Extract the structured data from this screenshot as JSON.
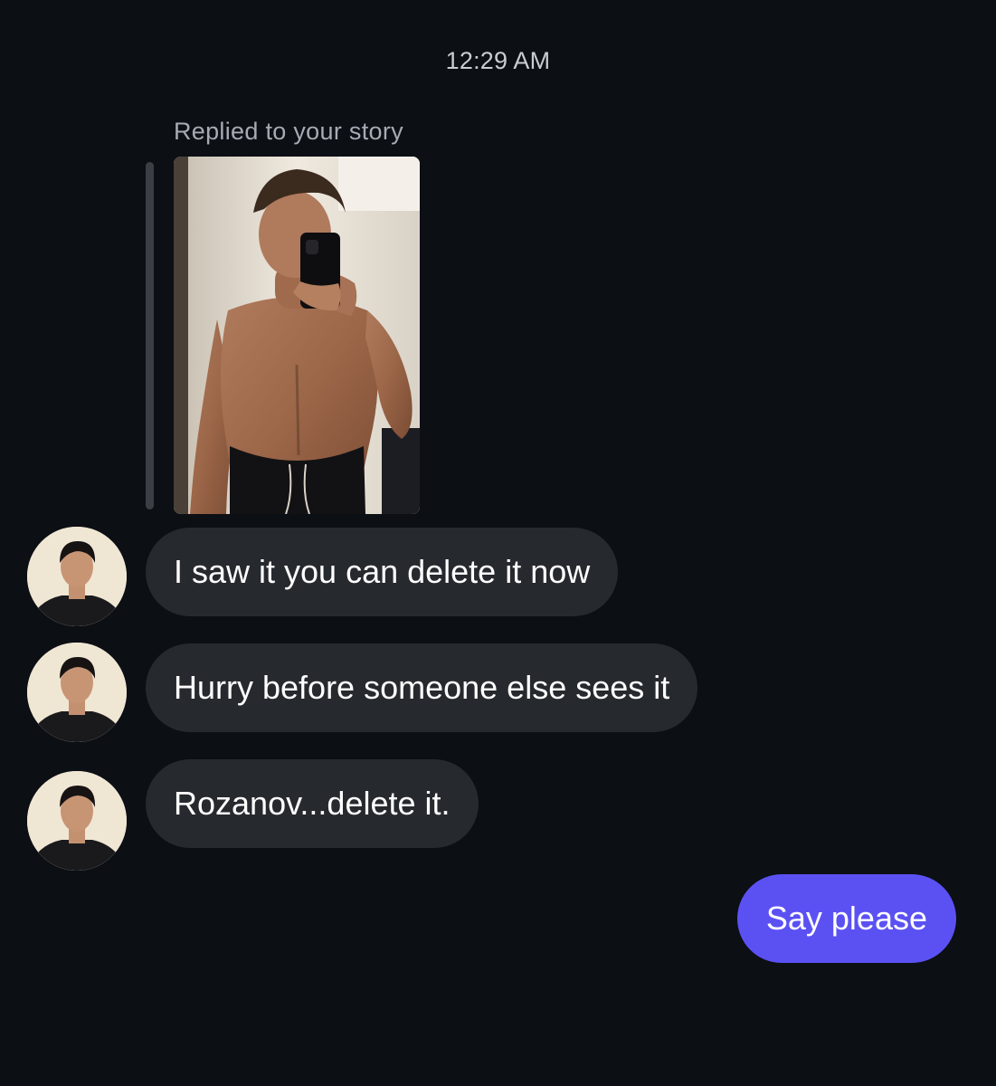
{
  "timestamp": "12:29 AM",
  "story_reply": {
    "label": "Replied to your story"
  },
  "messages": [
    {
      "from": "them",
      "text": "I saw it you can delete it now"
    },
    {
      "from": "them",
      "text": "Hurry before someone else sees it"
    },
    {
      "from": "them",
      "text": "Rozanov...delete it."
    },
    {
      "from": "me",
      "text": "Say please"
    }
  ],
  "colors": {
    "background": "#0c0f14",
    "incoming_bubble": "#26292e",
    "outgoing_bubble": "#5b51f3",
    "secondary_text": "#a7abb3"
  }
}
